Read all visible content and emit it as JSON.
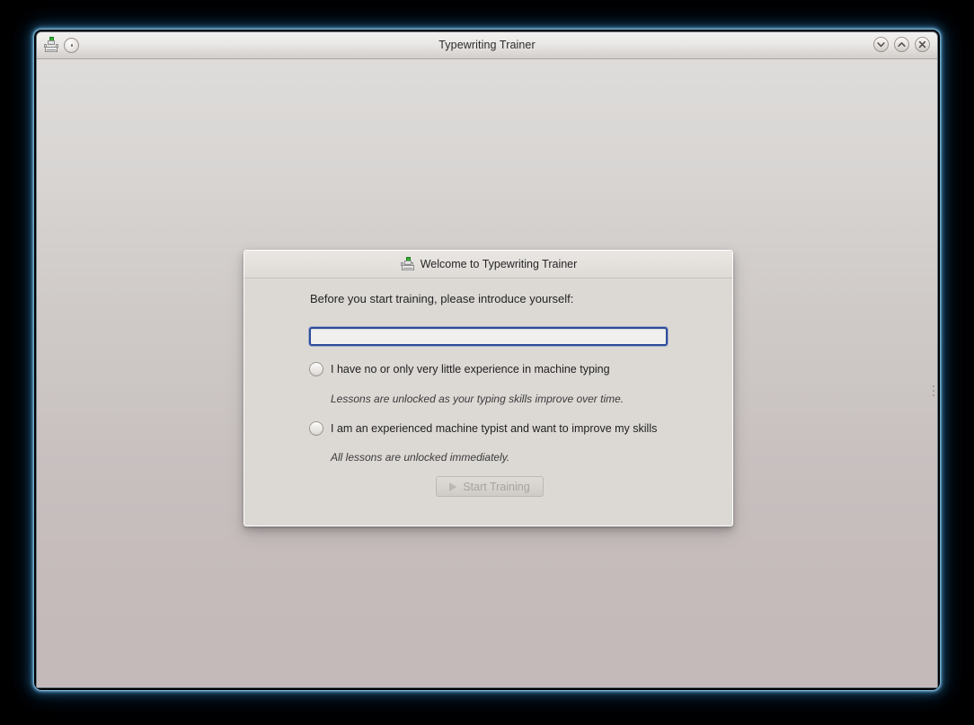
{
  "window": {
    "title": "Typewriting Trainer",
    "app_icon": "typewriter-icon",
    "menu_icon": "window-menu-icon",
    "buttons": {
      "minimize": "minimize-icon",
      "maximize": "maximize-icon",
      "close": "close-icon"
    }
  },
  "dialog": {
    "icon": "typewriter-icon",
    "caption": "Welcome to Typewriting Trainer",
    "prompt": "Before you start training, please introduce yourself:",
    "name_input": {
      "value": "",
      "placeholder": ""
    },
    "options": [
      {
        "label": "I have no or only very little experience in machine typing",
        "hint": "Lessons are unlocked as your typing skills improve over time.",
        "selected": false
      },
      {
        "label": "I am an experienced machine typist and want to improve my skills",
        "hint": "All lessons are unlocked immediately.",
        "selected": false
      }
    ],
    "start_button": {
      "label": "Start Training",
      "icon": "play-icon",
      "enabled": false
    }
  },
  "colors": {
    "focus_border": "#2c4c9c",
    "window_glow": "#5aa0cd",
    "desktop": "#000000",
    "client_top": "#dedcda",
    "client_bottom": "#c4baba",
    "dialog_bg": "#dcd9d5",
    "accent_green": "#35b034"
  }
}
